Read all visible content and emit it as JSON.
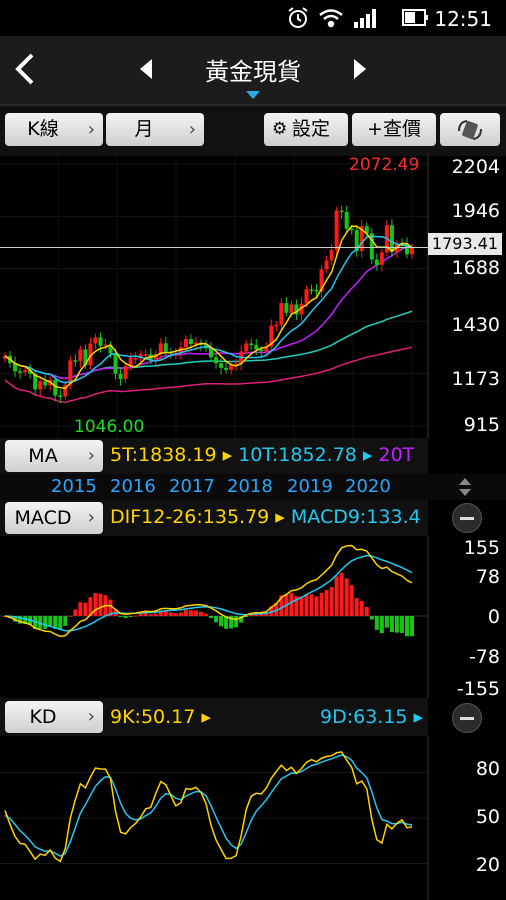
{
  "status": {
    "time": "12:51"
  },
  "nav": {
    "title": "黃金現貨"
  },
  "toolbar": {
    "kline_label": "K線",
    "period_label": "月",
    "settings_label": "設定",
    "quote_label": "+查價"
  },
  "main_chart": {
    "high_label": "2072.49",
    "low_label": "1046.00",
    "last_price": "1793.41",
    "y_ticks": [
      "2204",
      "1946",
      "1688",
      "1430",
      "1173",
      "915"
    ]
  },
  "ma": {
    "label": "MA",
    "ma5": "5T:1838.19",
    "ma10": "10T:1852.78",
    "ma20": "20T"
  },
  "years": [
    "2015",
    "2016",
    "2017",
    "2018",
    "2019",
    "2020"
  ],
  "macd": {
    "label": "MACD",
    "dif": "DIF12-26:135.79",
    "macd9": "MACD9:133.4",
    "y_ticks": [
      "155",
      "78",
      "0",
      "-78",
      "-155"
    ]
  },
  "kd": {
    "label": "KD",
    "k": "9K:50.17",
    "d": "9D:63.15",
    "y_ticks": [
      "80",
      "50",
      "20"
    ]
  },
  "colors": {
    "up": "#ff1a1a",
    "down": "#18c418",
    "ma5": "#ffd400",
    "ma10": "#22c8f0",
    "ma20": "#c020ff",
    "ma60": "#20d0c0",
    "ma120": "#e0207a"
  },
  "chart_data": {
    "type": "candlestick",
    "interval": "monthly",
    "x_years": [
      "2015",
      "2016",
      "2017",
      "2018",
      "2019",
      "2020"
    ],
    "ylim": [
      915,
      2204
    ],
    "close": [
      1260,
      1225,
      1184,
      1180,
      1190,
      1172,
      1095,
      1135,
      1115,
      1142,
      1065,
      1060,
      1118,
      1238,
      1234,
      1292,
      1214,
      1321,
      1351,
      1309,
      1315,
      1272,
      1172,
      1146,
      1211,
      1249,
      1249,
      1268,
      1268,
      1242,
      1269,
      1322,
      1280,
      1271,
      1275,
      1303,
      1343,
      1318,
      1325,
      1315,
      1298,
      1253,
      1224,
      1201,
      1191,
      1215,
      1222,
      1282,
      1321,
      1313,
      1292,
      1283,
      1305,
      1409,
      1413,
      1520,
      1472,
      1513,
      1464,
      1517,
      1587,
      1585,
      1577,
      1686,
      1730,
      1781,
      1975,
      1968,
      1886,
      1879,
      1776,
      1898,
      1863,
      1734,
      1708,
      1769,
      1903,
      1770,
      1814,
      1813,
      1760,
      1793
    ],
    "macd": {
      "ylim": [
        -155,
        155
      ],
      "dif_last": 135.79,
      "macd9_last": 133.4
    },
    "kd": {
      "ylim": [
        0,
        100
      ],
      "k_last": 50.17,
      "d_last": 63.15
    }
  }
}
